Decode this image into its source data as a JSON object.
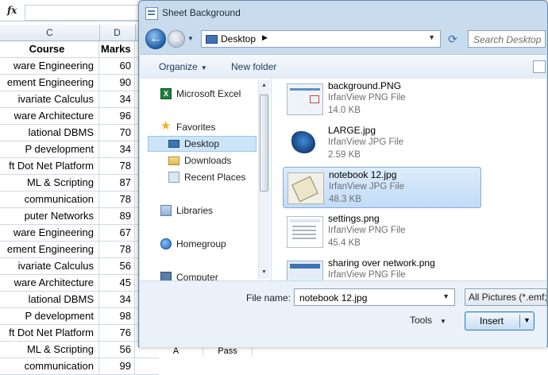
{
  "excel": {
    "formula_label": "fx",
    "col_c": "C",
    "col_d": "D",
    "header": {
      "course": "Course",
      "marks": "Marks"
    },
    "rows": [
      {
        "course": "ware Engineering",
        "marks": "60"
      },
      {
        "course": "ement Engineering",
        "marks": "90"
      },
      {
        "course": "ivariate Calculus",
        "marks": "34"
      },
      {
        "course": "ware Architecture",
        "marks": "96"
      },
      {
        "course": "lational DBMS",
        "marks": "70"
      },
      {
        "course": "P development",
        "marks": "34"
      },
      {
        "course": "ft Dot Net Platform",
        "marks": "78"
      },
      {
        "course": "ML & Scripting",
        "marks": "87"
      },
      {
        "course": "communication",
        "marks": "78"
      },
      {
        "course": "puter Networks",
        "marks": "89"
      },
      {
        "course": "ware Engineering",
        "marks": "67"
      },
      {
        "course": "ement Engineering",
        "marks": "78"
      },
      {
        "course": "ivariate Calculus",
        "marks": "56"
      },
      {
        "course": "ware Architecture",
        "marks": "45"
      },
      {
        "course": "lational DBMS",
        "marks": "34"
      },
      {
        "course": "P development",
        "marks": "98"
      },
      {
        "course": "ft Dot Net Platform",
        "marks": "76"
      },
      {
        "course": "ML & Scripting",
        "marks": "56"
      },
      {
        "course": "communication",
        "marks": "99"
      }
    ],
    "peek": {
      "grade": "A",
      "status": "Pass"
    }
  },
  "dialog": {
    "title": "Sheet Background",
    "address": {
      "location": "Desktop"
    },
    "search_placeholder": "Search Desktop",
    "toolbar": {
      "organize": "Organize",
      "new_folder": "New folder"
    },
    "nav": {
      "microsoft_excel": "Microsoft Excel",
      "favorites": "Favorites",
      "desktop": "Desktop",
      "downloads": "Downloads",
      "recent_places": "Recent Places",
      "libraries": "Libraries",
      "homegroup": "Homegroup",
      "computer": "Computer"
    },
    "files": [
      {
        "name": "background.PNG",
        "type": "IrfanView PNG File",
        "size": "14.0 KB"
      },
      {
        "name": "LARGE.jpg",
        "type": "IrfanView JPG File",
        "size": "2.59 KB"
      },
      {
        "name": "notebook 12.jpg",
        "type": "IrfanView JPG File",
        "size": "48.3 KB"
      },
      {
        "name": "settings.png",
        "type": "IrfanView PNG File",
        "size": "45.4 KB"
      },
      {
        "name": "sharing over network.png",
        "type": "IrfanView PNG File",
        "size": ""
      }
    ],
    "file_name_label": "File name:",
    "file_name_value": "notebook 12.jpg",
    "file_type_filter": "All Pictures (*.emf;",
    "tools_label": "Tools",
    "insert_label": "Insert"
  }
}
